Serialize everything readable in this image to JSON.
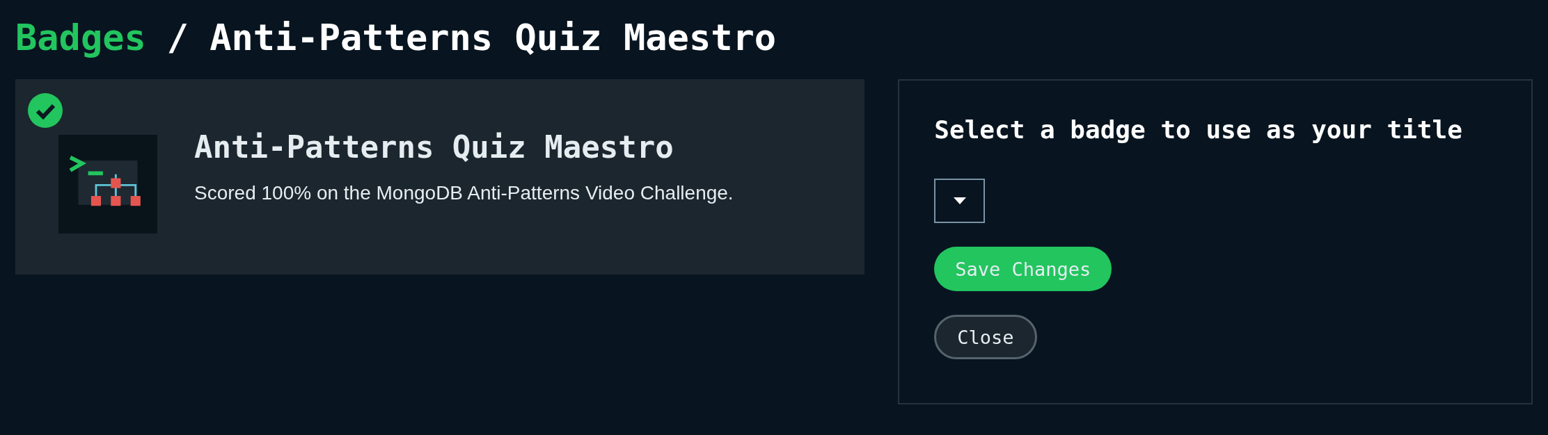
{
  "breadcrumb": {
    "parent": "Badges",
    "separator": "/",
    "current": "Anti-Patterns Quiz Maestro"
  },
  "badge": {
    "title": "Anti-Patterns Quiz Maestro",
    "description": "Scored 100% on the MongoDB Anti-Patterns Video Challenge.",
    "earned": true
  },
  "title_panel": {
    "heading": "Select a badge to use as your title",
    "buttons": [
      {
        "label": "Save Changes",
        "kind": "primary"
      },
      {
        "label": "Close",
        "kind": "secondary"
      }
    ]
  }
}
